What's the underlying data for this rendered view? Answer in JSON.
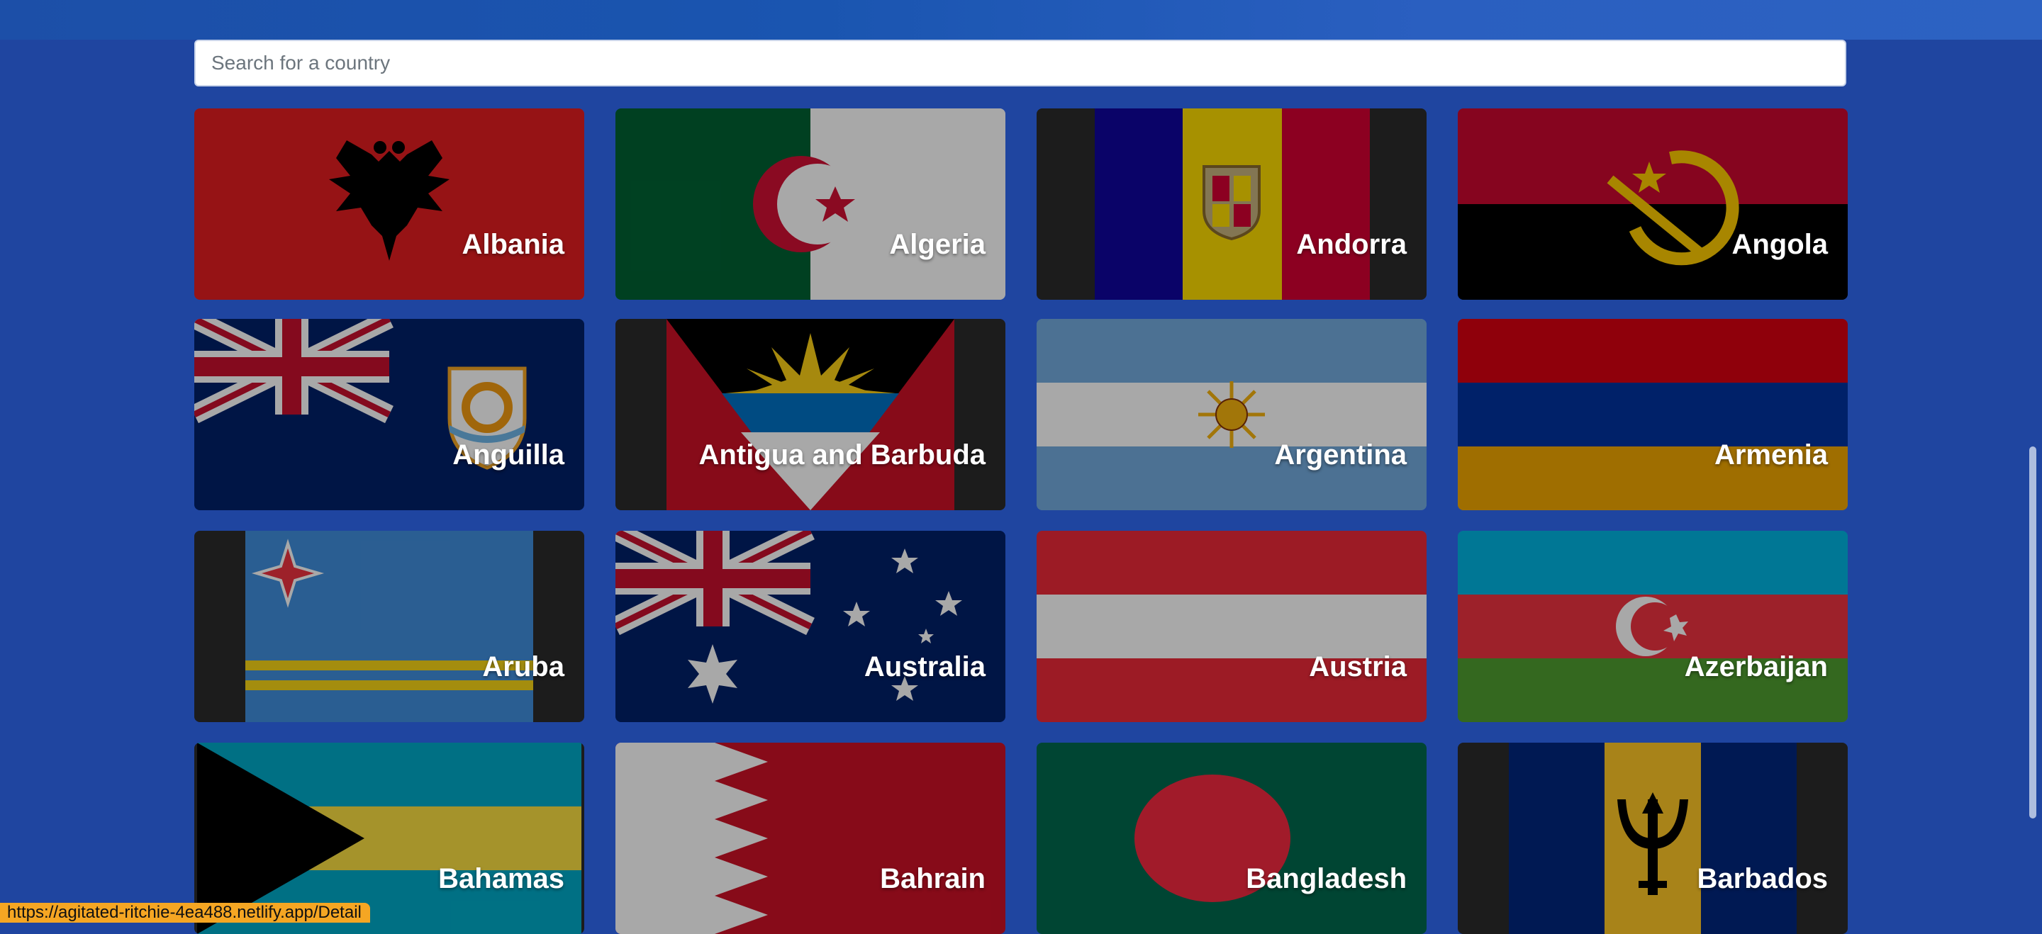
{
  "search": {
    "placeholder": "Search for a country",
    "value": ""
  },
  "countries": [
    {
      "name": "Albania",
      "flag": "albania-flag-icon"
    },
    {
      "name": "Algeria",
      "flag": "algeria-flag-icon"
    },
    {
      "name": "Andorra",
      "flag": "andorra-flag-icon"
    },
    {
      "name": "Angola",
      "flag": "angola-flag-icon"
    },
    {
      "name": "Anguilla",
      "flag": "anguilla-flag-icon"
    },
    {
      "name": "Antigua and Barbuda",
      "flag": "antigua-and-barbuda-flag-icon"
    },
    {
      "name": "Argentina",
      "flag": "argentina-flag-icon"
    },
    {
      "name": "Armenia",
      "flag": "armenia-flag-icon"
    },
    {
      "name": "Aruba",
      "flag": "aruba-flag-icon"
    },
    {
      "name": "Australia",
      "flag": "australia-flag-icon"
    },
    {
      "name": "Austria",
      "flag": "austria-flag-icon"
    },
    {
      "name": "Azerbaijan",
      "flag": "azerbaijan-flag-icon"
    },
    {
      "name": "Bahamas",
      "flag": "bahamas-flag-icon"
    },
    {
      "name": "Bahrain",
      "flag": "bahrain-flag-icon"
    },
    {
      "name": "Bangladesh",
      "flag": "bangladesh-flag-icon"
    },
    {
      "name": "Barbados",
      "flag": "barbados-flag-icon"
    }
  ],
  "status_bar": {
    "url": "https://agitated-ritchie-4ea488.netlify.app/Detail"
  },
  "colors": {
    "page_background": "#1f45a0",
    "status_bar": "#f5a623"
  }
}
